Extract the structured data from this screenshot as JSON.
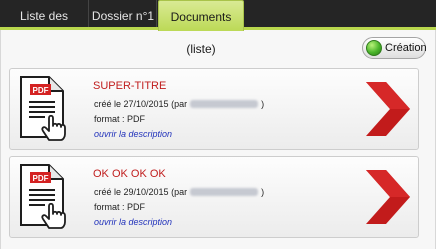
{
  "tabs": [
    {
      "label": "Liste des dossiers"
    },
    {
      "label": "Dossier n°1"
    },
    {
      "label": "Documents (liste)",
      "active": true
    }
  ],
  "toolbar": {
    "creation_label": "Création"
  },
  "documents": [
    {
      "title": "SUPER-TITRE",
      "created_label": "créé le 27/10/2015",
      "by_prefix": "(par",
      "by_suffix": ")",
      "format_label": "format : PDF",
      "icon_text": "PDF",
      "description_link": "ouvrir la description"
    },
    {
      "title": "OK OK OK OK",
      "created_label": "créé le 29/10/2015",
      "by_prefix": "(par",
      "by_suffix": ")",
      "format_label": "format : PDF",
      "icon_text": "PDF",
      "description_link": "ouvrir la description"
    }
  ],
  "colors": {
    "tab_bar": "#252525",
    "active_tab": "#c6df6e",
    "title_red": "#c01d1d",
    "link_blue": "#2233bb",
    "chevron_red": "#c21b1b"
  },
  "icons": {
    "document": "pdf-file-icon",
    "pointer": "hand-pointer-icon",
    "open": "chevron-right-icon",
    "status": "green-dot-icon"
  }
}
